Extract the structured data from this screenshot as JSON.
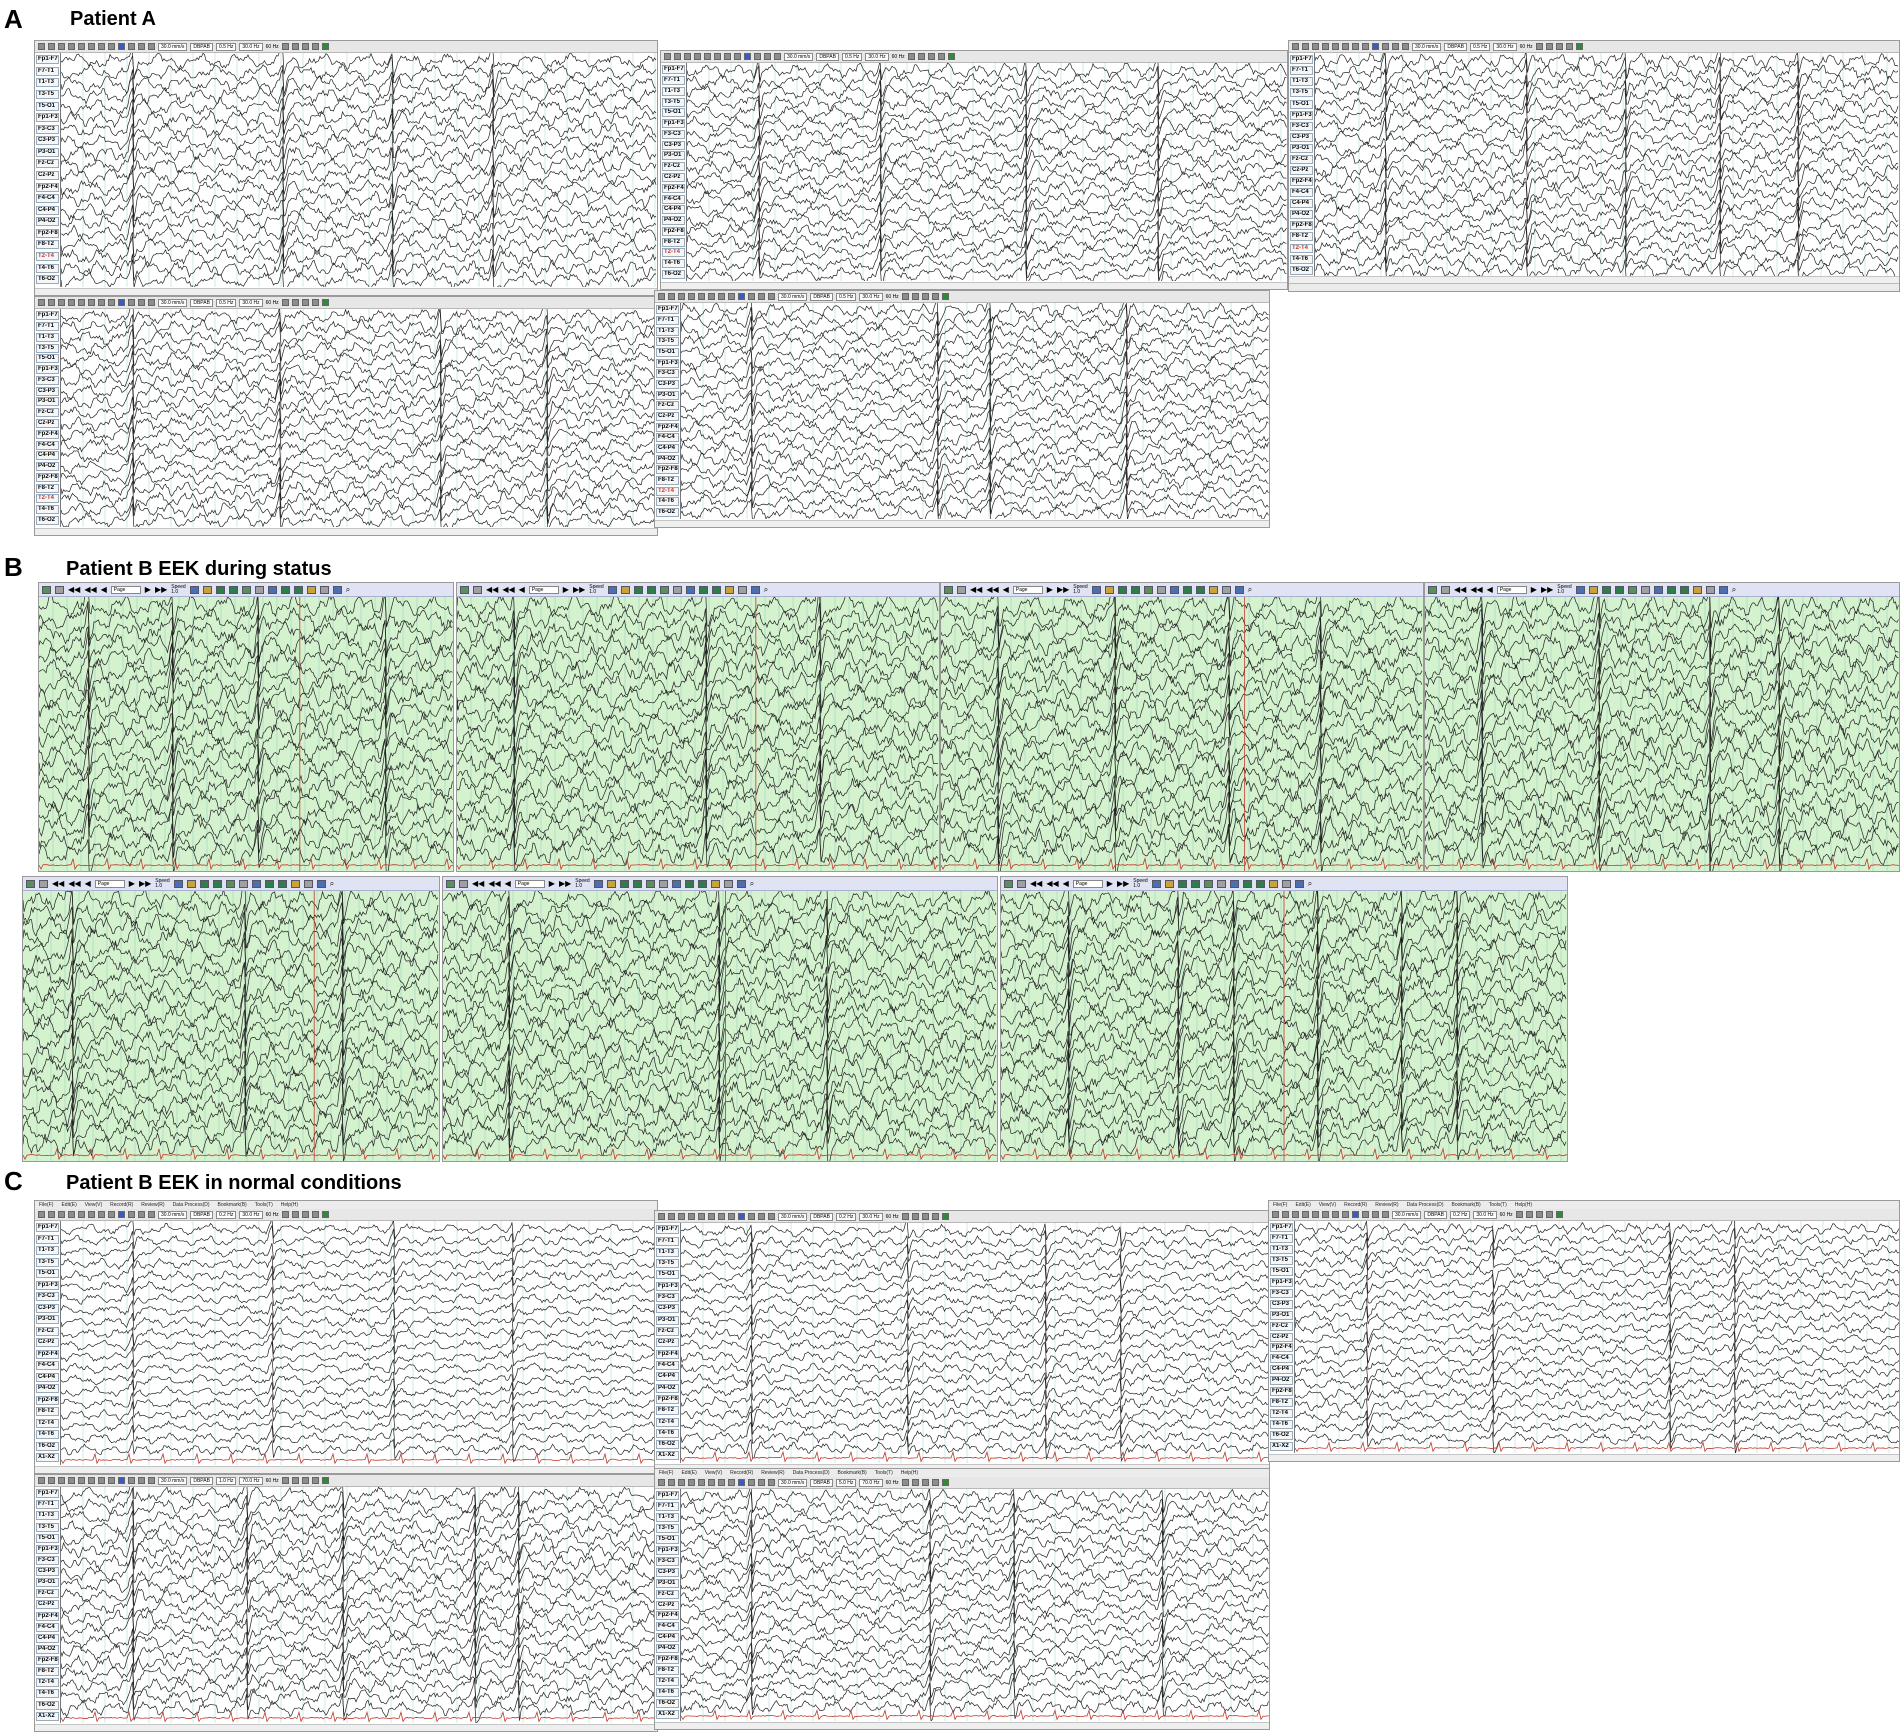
{
  "sections": [
    {
      "letter": "A",
      "title": "Patient A"
    },
    {
      "letter": "B",
      "title": "Patient B EEK during status"
    },
    {
      "letter": "C",
      "title": "Patient B EEK in normal conditions"
    }
  ],
  "toolbar": {
    "speed": "30.0 mm/s",
    "montage": "DBPAB",
    "lowcut_a": "0.5 Hz",
    "lowcut_c": "0.2 Hz",
    "lowcut_c4": "1.0 Hz",
    "lowcut_c5": "5.0 Hz",
    "highcut": "30.0 Hz",
    "highcut_c4": "70.0 Hz",
    "notch": "60 Hz",
    "page_label": "Page",
    "speed_label": "Speed",
    "speed_value": "1.0"
  },
  "menu": {
    "items": [
      "File(F)",
      "Edit(E)",
      "View(V)",
      "Record(R)",
      "Review(R)",
      "Data Process(D)",
      "Bookmark(B)",
      "Tools(T)",
      "Help(H)"
    ]
  },
  "channels_a": [
    "Fp1-F7",
    "F7-T1",
    "T1-T3",
    "T3-T5",
    "T5-O1",
    "Fp1-F3",
    "F3-C3",
    "C3-P3",
    "P3-O1",
    "Fz-Cz",
    "Cz-Pz",
    "Fp2-F4",
    "F4-C4",
    "C4-P4",
    "P4-O2",
    "Fp2-F8",
    "F8-T2",
    "T2-T4",
    "T4-T6",
    "T6-O2"
  ],
  "channels_c": [
    "Fp1-F7",
    "F7-T1",
    "T1-T3",
    "T3-T5",
    "T5-O1",
    "Fp1-F3",
    "F3-C3",
    "C3-P3",
    "P3-O1",
    "Fz-Cz",
    "Cz-Pz",
    "Fp2-F4",
    "F4-C4",
    "C4-P4",
    "P4-O2",
    "Fp2-F8",
    "F8-T2",
    "T2-T4",
    "T4-T6",
    "T6-O2",
    "X1-X2"
  ],
  "colors": {
    "trace": "#222222",
    "grid": "#5aa7a7",
    "ekg": "#c0392b",
    "green_bg": "#d5f2cf",
    "marker": "#c0392b"
  }
}
